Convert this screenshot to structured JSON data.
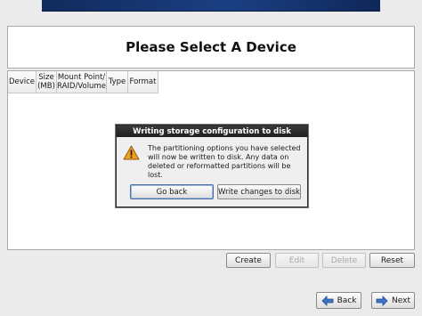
{
  "header": {
    "title": "Please Select A Device"
  },
  "table": {
    "columns": [
      "Device",
      "Size\n(MB)",
      "Mount Point/\nRAID/Volume",
      "Type",
      "Format"
    ]
  },
  "dialog": {
    "title": "Writing storage configuration to disk",
    "message": "The partitioning options you have selected will now be written to disk.  Any data on deleted or reformatted partitions will be lost.",
    "go_back_label": "Go back",
    "write_label": "Write changes to disk",
    "icon": "warning-icon"
  },
  "actions": {
    "create": "Create",
    "edit": "Edit",
    "delete": "Delete",
    "reset": "Reset"
  },
  "nav": {
    "back": "Back",
    "next": "Next"
  },
  "colors": {
    "banner": "#1b3f83",
    "dialog_title_bg": "#1e1e1e",
    "warning": "#f0a020"
  }
}
